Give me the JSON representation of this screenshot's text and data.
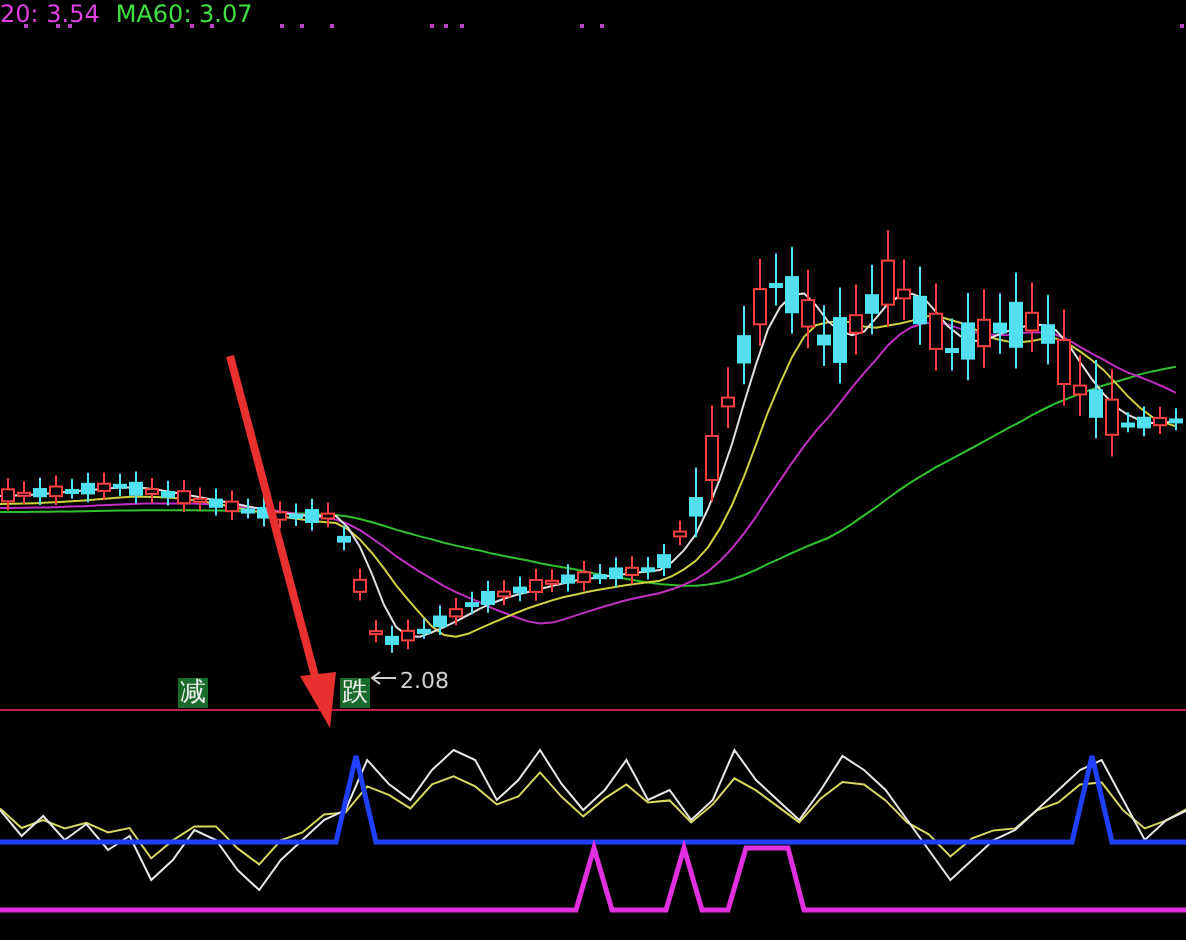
{
  "legend": [
    {
      "text": "20: 3.54",
      "color": "#e040e0"
    },
    {
      "text": "MA60: 3.07",
      "color": "#40e040"
    }
  ],
  "signals": [
    {
      "text": "减"
    },
    {
      "text": "跌"
    }
  ],
  "low_price": "2.08"
}
